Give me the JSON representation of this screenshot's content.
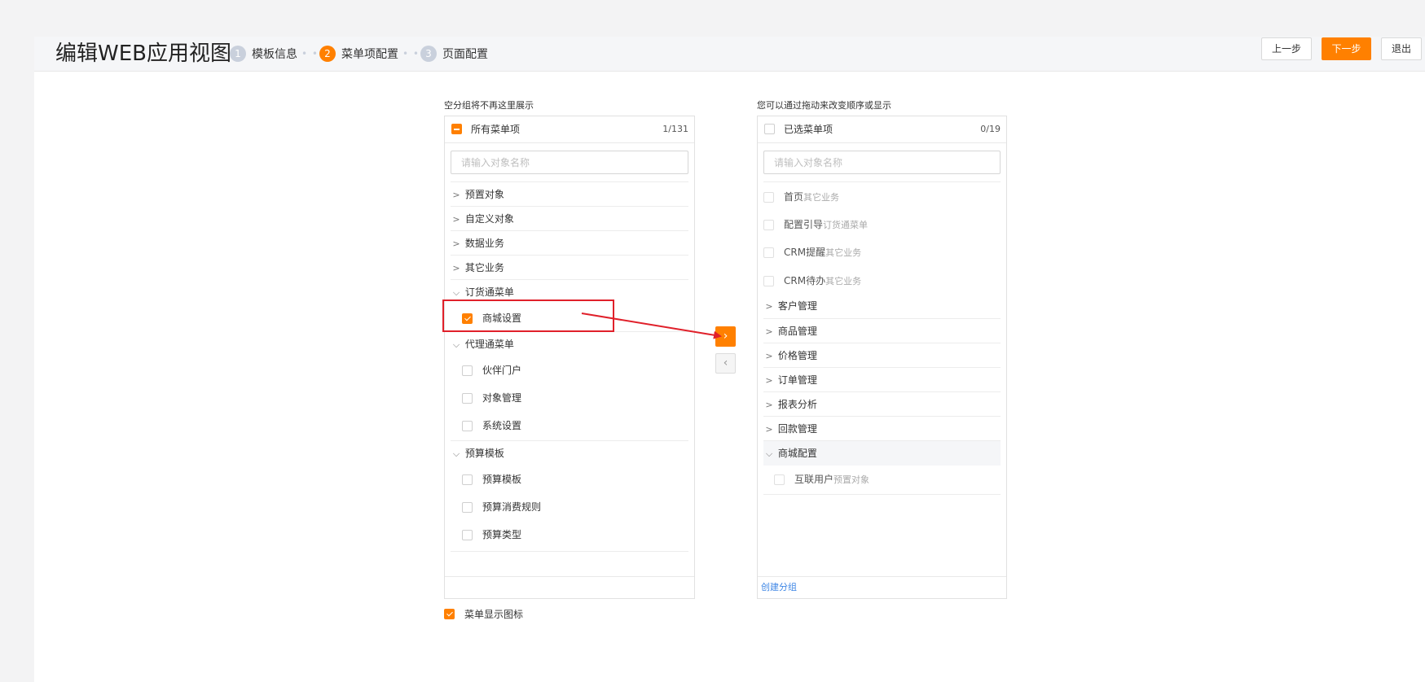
{
  "header": {
    "title": "编辑WEB应用视图",
    "steps": [
      {
        "num": "1",
        "label": "模板信息"
      },
      {
        "num": "2",
        "label": "菜单项配置"
      },
      {
        "num": "3",
        "label": "页面配置"
      }
    ],
    "step_dots": "• •",
    "prev_label": "上一步",
    "next_label": "下一步",
    "exit_label": "退出"
  },
  "left_panel": {
    "caption": "空分组将不再这里展示",
    "head_label": "所有菜单项",
    "count": "1/131",
    "search_placeholder": "请输入对象名称",
    "groups": [
      {
        "label": "预置对象"
      },
      {
        "label": "自定义对象"
      },
      {
        "label": "数据业务"
      },
      {
        "label": "其它业务"
      },
      {
        "label": "订货通菜单",
        "items": [
          {
            "label": "商城设置",
            "checked": true
          }
        ]
      },
      {
        "label": "代理通菜单",
        "items": [
          {
            "label": "伙伴门户",
            "checked": false
          },
          {
            "label": "对象管理",
            "checked": false
          },
          {
            "label": "系统设置",
            "checked": false
          }
        ]
      },
      {
        "label": "预算模板",
        "items": [
          {
            "label": "预算模板",
            "checked": false
          },
          {
            "label": "预算消费规则",
            "checked": false
          },
          {
            "label": "预算类型",
            "checked": false
          }
        ]
      }
    ]
  },
  "right_panel": {
    "caption": "您可以通过拖动来改变顺序或显示",
    "head_label": "已选菜单项",
    "count": "0/19",
    "search_placeholder": "请输入对象名称",
    "top_items": [
      {
        "label": "首页",
        "sub": "其它业务"
      },
      {
        "label": "配置引导",
        "sub": "订货通菜单"
      },
      {
        "label": "CRM提醒",
        "sub": "其它业务"
      },
      {
        "label": "CRM待办",
        "sub": "其它业务"
      }
    ],
    "groups": [
      {
        "label": "客户管理"
      },
      {
        "label": "商品管理"
      },
      {
        "label": "价格管理"
      },
      {
        "label": "订单管理"
      },
      {
        "label": "报表分析"
      },
      {
        "label": "回款管理"
      },
      {
        "label": "商城配置",
        "items": [
          {
            "label": "互联用户",
            "sub": "预置对象"
          }
        ]
      }
    ],
    "footer_link": "创建分组"
  },
  "transfer": {
    "right_arrow": "›",
    "left_arrow": "‹"
  },
  "options": {
    "show_icons_label": "菜单显示图标",
    "show_icons_checked": true
  },
  "colors": {
    "accent": "#ff8000",
    "annotation": "#e0202a",
    "link": "#3e86e5"
  },
  "icons": {
    "collapsed": "chevron-right-icon",
    "expanded": "chevron-down-icon"
  }
}
